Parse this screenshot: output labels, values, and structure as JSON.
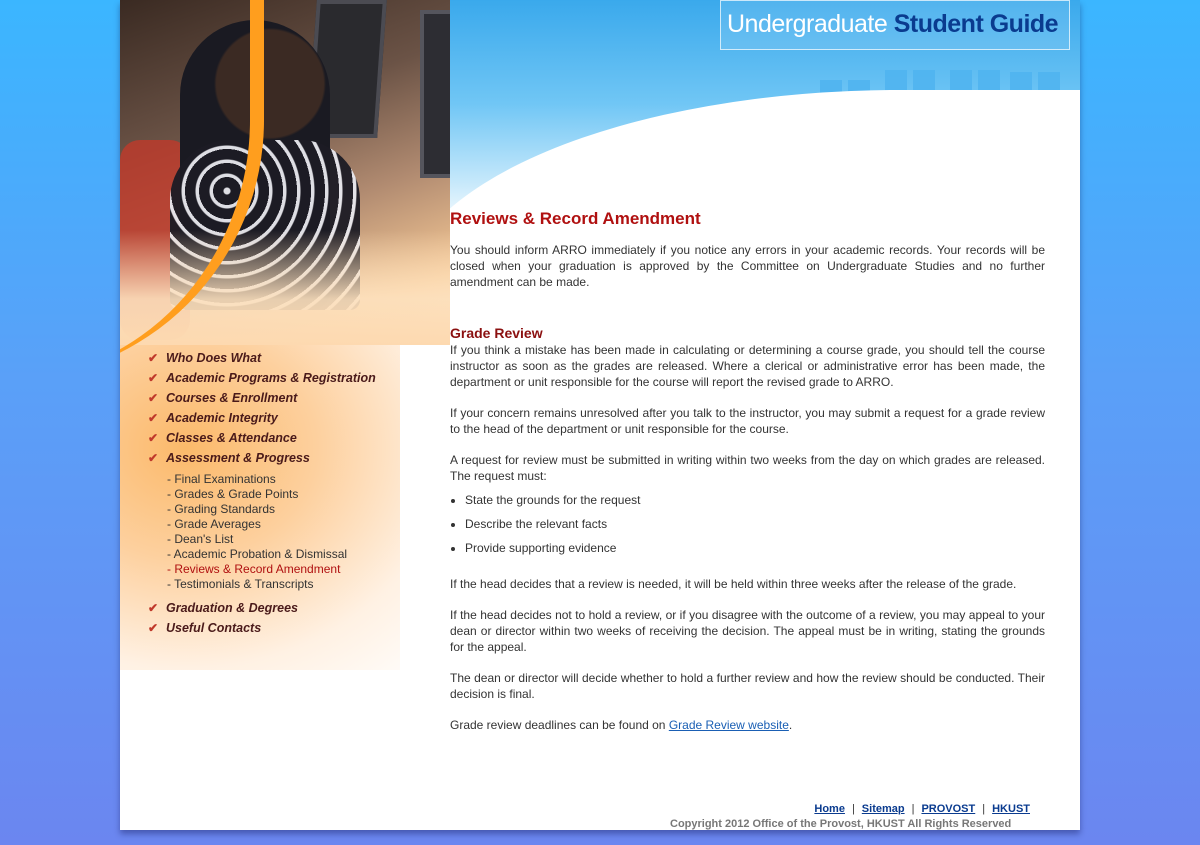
{
  "header": {
    "title_part1": "Undergraduate ",
    "title_part2": "Student Guide"
  },
  "nav": {
    "items": [
      {
        "label": "Who Does What"
      },
      {
        "label": "Academic Programs & Registration"
      },
      {
        "label": "Courses & Enrollment"
      },
      {
        "label": "Academic Integrity"
      },
      {
        "label": "Classes & Attendance"
      },
      {
        "label": "Assessment & Progress"
      },
      {
        "label": "Graduation & Degrees"
      },
      {
        "label": "Useful Contacts"
      }
    ],
    "sub_items": [
      {
        "label": "- Final Examinations"
      },
      {
        "label": "- Grades & Grade Points"
      },
      {
        "label": "- Grading Standards"
      },
      {
        "label": "- Grade Averages"
      },
      {
        "label": "- Dean's List"
      },
      {
        "label": "- Academic Probation & Dismissal"
      },
      {
        "label": "- Reviews & Record Amendment"
      },
      {
        "label": "- Testimonials & Transcripts"
      }
    ]
  },
  "content": {
    "title": "Reviews & Record Amendment",
    "intro": "You should inform ARRO immediately if you notice any errors in your academic records. Your records will be closed when your graduation is approved by the Committee on Undergraduate Studies and no further amendment can be made.",
    "section_title": "Grade Review",
    "p1": "If you think a mistake has been made in calculating or determining a course grade, you should tell the course instructor as soon as the grades are released. Where a clerical or administrative error has been made, the department or unit responsible for the course will report the revised grade to ARRO.",
    "p2": "If your concern remains unresolved after you talk to the instructor, you may submit a request for a grade review to the head of the department or unit responsible for the course.",
    "p3": "A request for review must be submitted in writing within two weeks from the day on which grades are released. The request must:",
    "bullets": [
      "State the grounds for the request",
      "Describe the relevant facts",
      "Provide supporting evidence"
    ],
    "p4": "If the head decides that a review is needed, it will be held within three weeks after the release of the grade.",
    "p5": "If the head decides not to hold a review, or if you disagree with the outcome of a review, you may appeal to your dean or director within two weeks of receiving the decision. The appeal must be in writing, stating the grounds for the appeal.",
    "p6": "The dean or director will decide whether to hold a further review and how the review should be conducted. Their decision is final.",
    "p7_prefix": "Grade review deadlines can be found on ",
    "p7_link": "Grade Review website",
    "p7_suffix": "."
  },
  "footer": {
    "home": "Home",
    "sitemap": "Sitemap",
    "provost": "PROVOST",
    "hkust": "HKUST",
    "separator": "|",
    "copyright": "Copyright 2012 Office of the Provost, HKUST   All Rights Reserved"
  },
  "colors": {
    "heading_red": "#b01010",
    "link_blue": "#1a5fb4",
    "nav_chevron": "#c0392b",
    "title_navy": "#0a3b8f"
  }
}
